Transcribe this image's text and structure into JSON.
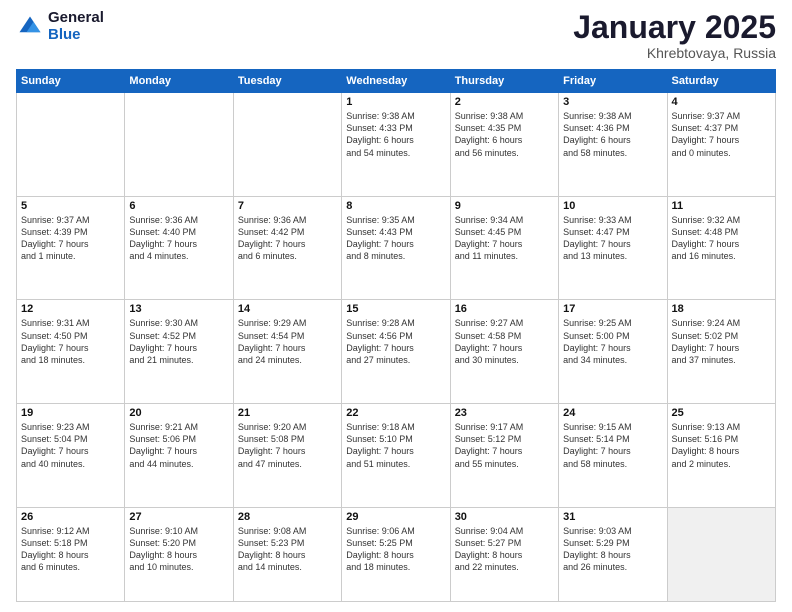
{
  "logo": {
    "general": "General",
    "blue": "Blue"
  },
  "header": {
    "month": "January 2025",
    "location": "Khrebtovaya, Russia"
  },
  "weekdays": [
    "Sunday",
    "Monday",
    "Tuesday",
    "Wednesday",
    "Thursday",
    "Friday",
    "Saturday"
  ],
  "weeks": [
    [
      {
        "day": "",
        "text": ""
      },
      {
        "day": "",
        "text": ""
      },
      {
        "day": "",
        "text": ""
      },
      {
        "day": "1",
        "text": "Sunrise: 9:38 AM\nSunset: 4:33 PM\nDaylight: 6 hours\nand 54 minutes."
      },
      {
        "day": "2",
        "text": "Sunrise: 9:38 AM\nSunset: 4:35 PM\nDaylight: 6 hours\nand 56 minutes."
      },
      {
        "day": "3",
        "text": "Sunrise: 9:38 AM\nSunset: 4:36 PM\nDaylight: 6 hours\nand 58 minutes."
      },
      {
        "day": "4",
        "text": "Sunrise: 9:37 AM\nSunset: 4:37 PM\nDaylight: 7 hours\nand 0 minutes."
      }
    ],
    [
      {
        "day": "5",
        "text": "Sunrise: 9:37 AM\nSunset: 4:39 PM\nDaylight: 7 hours\nand 1 minute."
      },
      {
        "day": "6",
        "text": "Sunrise: 9:36 AM\nSunset: 4:40 PM\nDaylight: 7 hours\nand 4 minutes."
      },
      {
        "day": "7",
        "text": "Sunrise: 9:36 AM\nSunset: 4:42 PM\nDaylight: 7 hours\nand 6 minutes."
      },
      {
        "day": "8",
        "text": "Sunrise: 9:35 AM\nSunset: 4:43 PM\nDaylight: 7 hours\nand 8 minutes."
      },
      {
        "day": "9",
        "text": "Sunrise: 9:34 AM\nSunset: 4:45 PM\nDaylight: 7 hours\nand 11 minutes."
      },
      {
        "day": "10",
        "text": "Sunrise: 9:33 AM\nSunset: 4:47 PM\nDaylight: 7 hours\nand 13 minutes."
      },
      {
        "day": "11",
        "text": "Sunrise: 9:32 AM\nSunset: 4:48 PM\nDaylight: 7 hours\nand 16 minutes."
      }
    ],
    [
      {
        "day": "12",
        "text": "Sunrise: 9:31 AM\nSunset: 4:50 PM\nDaylight: 7 hours\nand 18 minutes."
      },
      {
        "day": "13",
        "text": "Sunrise: 9:30 AM\nSunset: 4:52 PM\nDaylight: 7 hours\nand 21 minutes."
      },
      {
        "day": "14",
        "text": "Sunrise: 9:29 AM\nSunset: 4:54 PM\nDaylight: 7 hours\nand 24 minutes."
      },
      {
        "day": "15",
        "text": "Sunrise: 9:28 AM\nSunset: 4:56 PM\nDaylight: 7 hours\nand 27 minutes."
      },
      {
        "day": "16",
        "text": "Sunrise: 9:27 AM\nSunset: 4:58 PM\nDaylight: 7 hours\nand 30 minutes."
      },
      {
        "day": "17",
        "text": "Sunrise: 9:25 AM\nSunset: 5:00 PM\nDaylight: 7 hours\nand 34 minutes."
      },
      {
        "day": "18",
        "text": "Sunrise: 9:24 AM\nSunset: 5:02 PM\nDaylight: 7 hours\nand 37 minutes."
      }
    ],
    [
      {
        "day": "19",
        "text": "Sunrise: 9:23 AM\nSunset: 5:04 PM\nDaylight: 7 hours\nand 40 minutes."
      },
      {
        "day": "20",
        "text": "Sunrise: 9:21 AM\nSunset: 5:06 PM\nDaylight: 7 hours\nand 44 minutes."
      },
      {
        "day": "21",
        "text": "Sunrise: 9:20 AM\nSunset: 5:08 PM\nDaylight: 7 hours\nand 47 minutes."
      },
      {
        "day": "22",
        "text": "Sunrise: 9:18 AM\nSunset: 5:10 PM\nDaylight: 7 hours\nand 51 minutes."
      },
      {
        "day": "23",
        "text": "Sunrise: 9:17 AM\nSunset: 5:12 PM\nDaylight: 7 hours\nand 55 minutes."
      },
      {
        "day": "24",
        "text": "Sunrise: 9:15 AM\nSunset: 5:14 PM\nDaylight: 7 hours\nand 58 minutes."
      },
      {
        "day": "25",
        "text": "Sunrise: 9:13 AM\nSunset: 5:16 PM\nDaylight: 8 hours\nand 2 minutes."
      }
    ],
    [
      {
        "day": "26",
        "text": "Sunrise: 9:12 AM\nSunset: 5:18 PM\nDaylight: 8 hours\nand 6 minutes."
      },
      {
        "day": "27",
        "text": "Sunrise: 9:10 AM\nSunset: 5:20 PM\nDaylight: 8 hours\nand 10 minutes."
      },
      {
        "day": "28",
        "text": "Sunrise: 9:08 AM\nSunset: 5:23 PM\nDaylight: 8 hours\nand 14 minutes."
      },
      {
        "day": "29",
        "text": "Sunrise: 9:06 AM\nSunset: 5:25 PM\nDaylight: 8 hours\nand 18 minutes."
      },
      {
        "day": "30",
        "text": "Sunrise: 9:04 AM\nSunset: 5:27 PM\nDaylight: 8 hours\nand 22 minutes."
      },
      {
        "day": "31",
        "text": "Sunrise: 9:03 AM\nSunset: 5:29 PM\nDaylight: 8 hours\nand 26 minutes."
      },
      {
        "day": "",
        "text": ""
      }
    ]
  ]
}
